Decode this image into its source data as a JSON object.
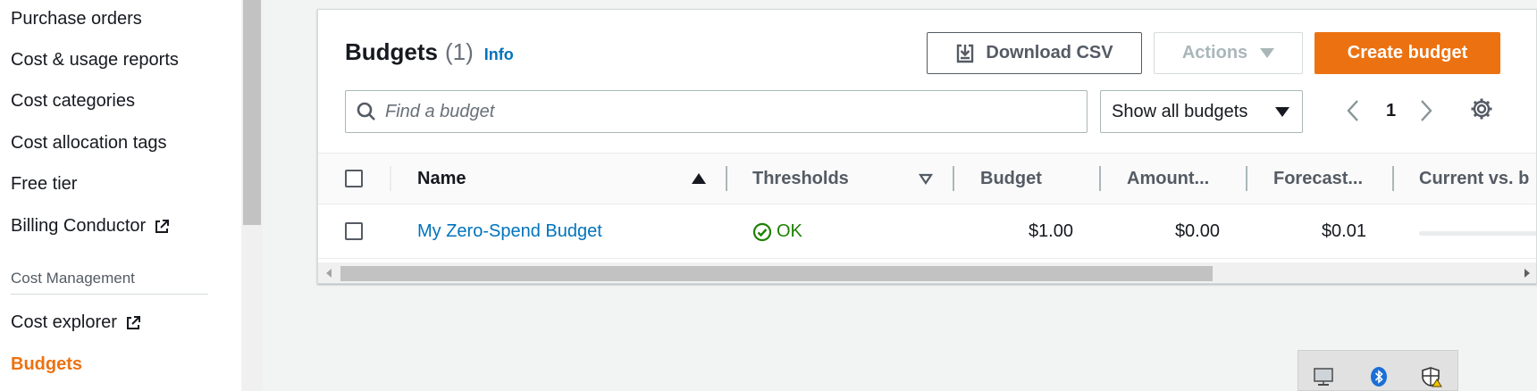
{
  "sidebar": {
    "items": [
      {
        "label": "Purchase orders"
      },
      {
        "label": "Cost & usage reports"
      },
      {
        "label": "Cost categories"
      },
      {
        "label": "Cost allocation tags"
      },
      {
        "label": "Free tier"
      },
      {
        "label": "Billing Conductor",
        "icon": "external-link-icon"
      }
    ],
    "section_title": "Cost Management",
    "section_items": [
      {
        "label": "Cost explorer",
        "icon": "external-link-icon"
      },
      {
        "label": "Budgets",
        "active": true
      }
    ]
  },
  "panel": {
    "title": "Budgets",
    "count": "(1)",
    "info": "Info",
    "download_label": "Download CSV",
    "actions_label": "Actions",
    "create_label": "Create budget",
    "search_placeholder": "Find a budget",
    "filter_selected": "Show all budgets",
    "page_number": "1",
    "columns": [
      "Name",
      "Thresholds",
      "Budget",
      "Amount...",
      "Forecast...",
      "Current vs. b"
    ],
    "rows": [
      {
        "name": "My Zero-Spend Budget",
        "threshold_status": "OK",
        "budget": "$1.00",
        "amount": "$0.00",
        "forecast": "$0.01"
      }
    ]
  },
  "colors": {
    "accent": "#ec7211",
    "link": "#0073bb",
    "ok": "#1d8102"
  }
}
